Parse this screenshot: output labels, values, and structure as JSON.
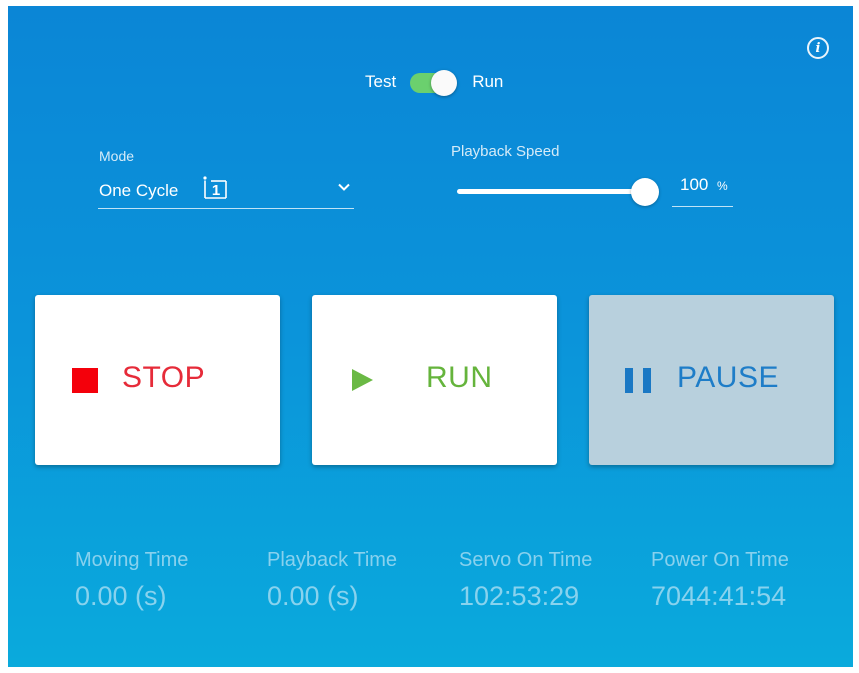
{
  "header": {
    "info_icon": "info-icon",
    "toggle": {
      "left_label": "Test",
      "right_label": "Run",
      "state": "Run",
      "color": "#6bd06e"
    }
  },
  "mode": {
    "label": "Mode",
    "value": "One Cycle",
    "icon": "one-cycle-icon"
  },
  "playback_speed": {
    "label": "Playback Speed",
    "value": "100",
    "unit": "%",
    "fraction": 1.0
  },
  "buttons": {
    "stop": {
      "label": "STOP",
      "color": "#e62b39",
      "icon": "stop-square-icon"
    },
    "run": {
      "label": "RUN",
      "color": "#65b43c",
      "icon": "play-icon"
    },
    "pause": {
      "label": "PAUSE",
      "color": "#1e7dc8",
      "icon": "pause-icon",
      "state": "active"
    }
  },
  "stats": [
    {
      "title": "Moving Time",
      "value": "0.00 (s)"
    },
    {
      "title": "Playback Time",
      "value": "0.00 (s)"
    },
    {
      "title": "Servo On Time",
      "value": "102:53:29"
    },
    {
      "title": "Power On Time",
      "value": "7044:41:54"
    }
  ],
  "colors": {
    "background": "#0b94da",
    "accent": "#6bd06e"
  }
}
